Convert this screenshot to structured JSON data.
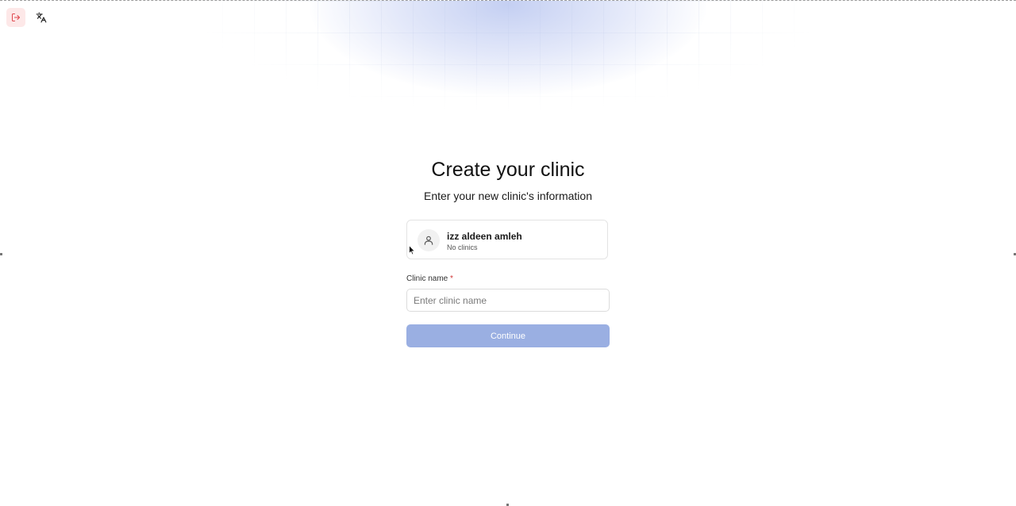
{
  "toolbar": {
    "logout_icon": "logout-icon",
    "translate_icon": "translate-icon"
  },
  "header": {
    "title": "Create your clinic",
    "subtitle": "Enter your new clinic's information"
  },
  "user": {
    "name": "izz aldeen amleh",
    "status": "No clinics",
    "avatar_icon": "user-icon"
  },
  "form": {
    "clinic_name_label": "Clinic name",
    "required_mark": "*",
    "clinic_name_value": "",
    "clinic_name_placeholder": "Enter clinic name",
    "continue_label": "Continue"
  },
  "colors": {
    "accent_disabled": "#9aafe2",
    "logout_bg": "#fde8e8",
    "logout_icon": "#e0484e",
    "required": "#d03434"
  }
}
